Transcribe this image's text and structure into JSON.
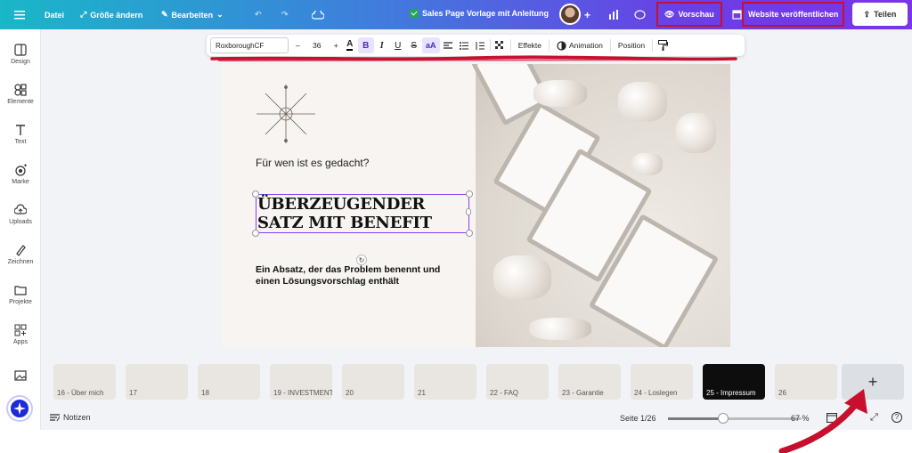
{
  "topbar": {
    "file_menu": "Datei",
    "resize": "Größe ändern",
    "edit": "Bearbeiten",
    "doc_title": "Sales Page Vorlage mit Anleitung",
    "preview": "Vorschau",
    "publish": "Website veröffentlichen",
    "share": "Teilen"
  },
  "context_toolbar": {
    "font": "RoxboroughCF",
    "font_size": "36",
    "decrease": "–",
    "increase": "+",
    "bold": "B",
    "italic": "I",
    "underline": "U",
    "strike": "S",
    "case": "aA",
    "effects": "Effekte",
    "animation": "Animation",
    "position": "Position"
  },
  "sidebar": {
    "items": [
      {
        "label": "Design",
        "icon": "layout-icon"
      },
      {
        "label": "Elemente",
        "icon": "shapes-icon"
      },
      {
        "label": "Text",
        "icon": "text-icon"
      },
      {
        "label": "Marke",
        "icon": "brand-icon"
      },
      {
        "label": "Uploads",
        "icon": "cloud-upload-icon"
      },
      {
        "label": "Zeichnen",
        "icon": "pen-icon"
      },
      {
        "label": "Projekte",
        "icon": "folder-icon"
      },
      {
        "label": "Apps",
        "icon": "apps-icon"
      }
    ]
  },
  "page": {
    "subheading": "Für wen ist es gedacht?",
    "headline": "ÜBERZEUGENDER\nSATZ MIT BENEFIT",
    "paragraph": "Ein Absatz, der das Problem benennt und einen Lösungsvorschlag enthält"
  },
  "thumbnails": [
    {
      "label": "16 - Über mich",
      "dark": false
    },
    {
      "label": "17",
      "dark": false
    },
    {
      "label": "18",
      "dark": false
    },
    {
      "label": "19 - INVESTMENT",
      "dark": false
    },
    {
      "label": "20",
      "dark": false
    },
    {
      "label": "21",
      "dark": false
    },
    {
      "label": "22 - FAQ",
      "dark": false
    },
    {
      "label": "23 - Garantie",
      "dark": false
    },
    {
      "label": "24 - Loslegen",
      "dark": false
    },
    {
      "label": "25 - Impressum",
      "dark": true
    },
    {
      "label": "26",
      "dark": false
    }
  ],
  "add_page": "+",
  "bottom": {
    "notes": "Notizen",
    "page_indicator": "Seite 1/26",
    "zoom": "67 %",
    "zoom_level": 0.41
  },
  "colors": {
    "accent": "#8b3dff",
    "highlight": "#c8102e",
    "topbar_start": "#19b7c8",
    "topbar_end": "#7b34e8"
  }
}
